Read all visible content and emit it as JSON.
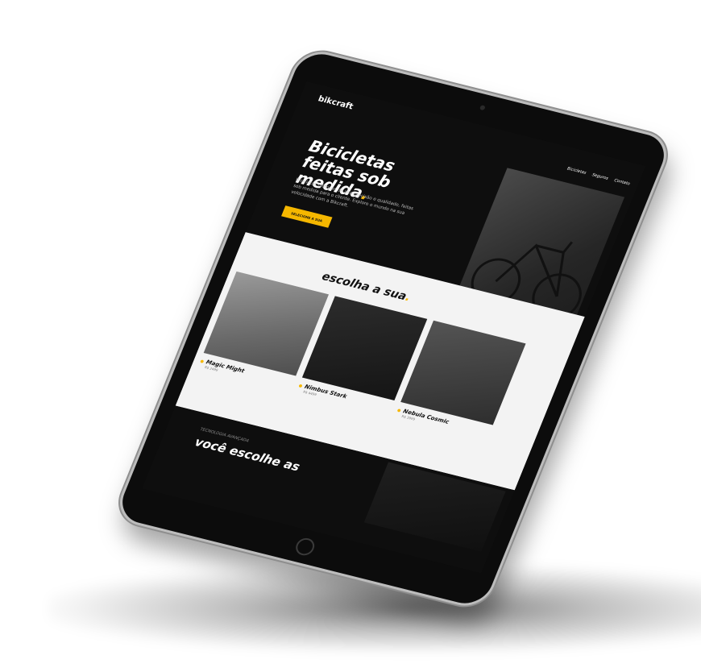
{
  "brand": {
    "name": "bikcraft",
    "accent": "#f5b700"
  },
  "nav": {
    "items": [
      "Bicicletas",
      "Seguros",
      "Contato"
    ]
  },
  "hero": {
    "title": "Bicicletas feitas sob medida",
    "title_dot": ".",
    "text": "Bicicletas elétricas de alta precisão e qualidade, feitas sob medida para o cliente. Explore o mundo na sua velocidade com a Bikcraft.",
    "cta": "SELECIONE A SUA"
  },
  "products": {
    "title": "escolha a sua",
    "title_dot": ".",
    "items": [
      {
        "name": "Magic Might",
        "price": "R$ 2499"
      },
      {
        "name": "Nimbus Stark",
        "price": "R$ 4499"
      },
      {
        "name": "Nebula Cosmic",
        "price": "R$ 3999"
      }
    ]
  },
  "tech": {
    "kicker": "TECNOLOGIA AVANÇADA",
    "title": "você escolhe as"
  }
}
